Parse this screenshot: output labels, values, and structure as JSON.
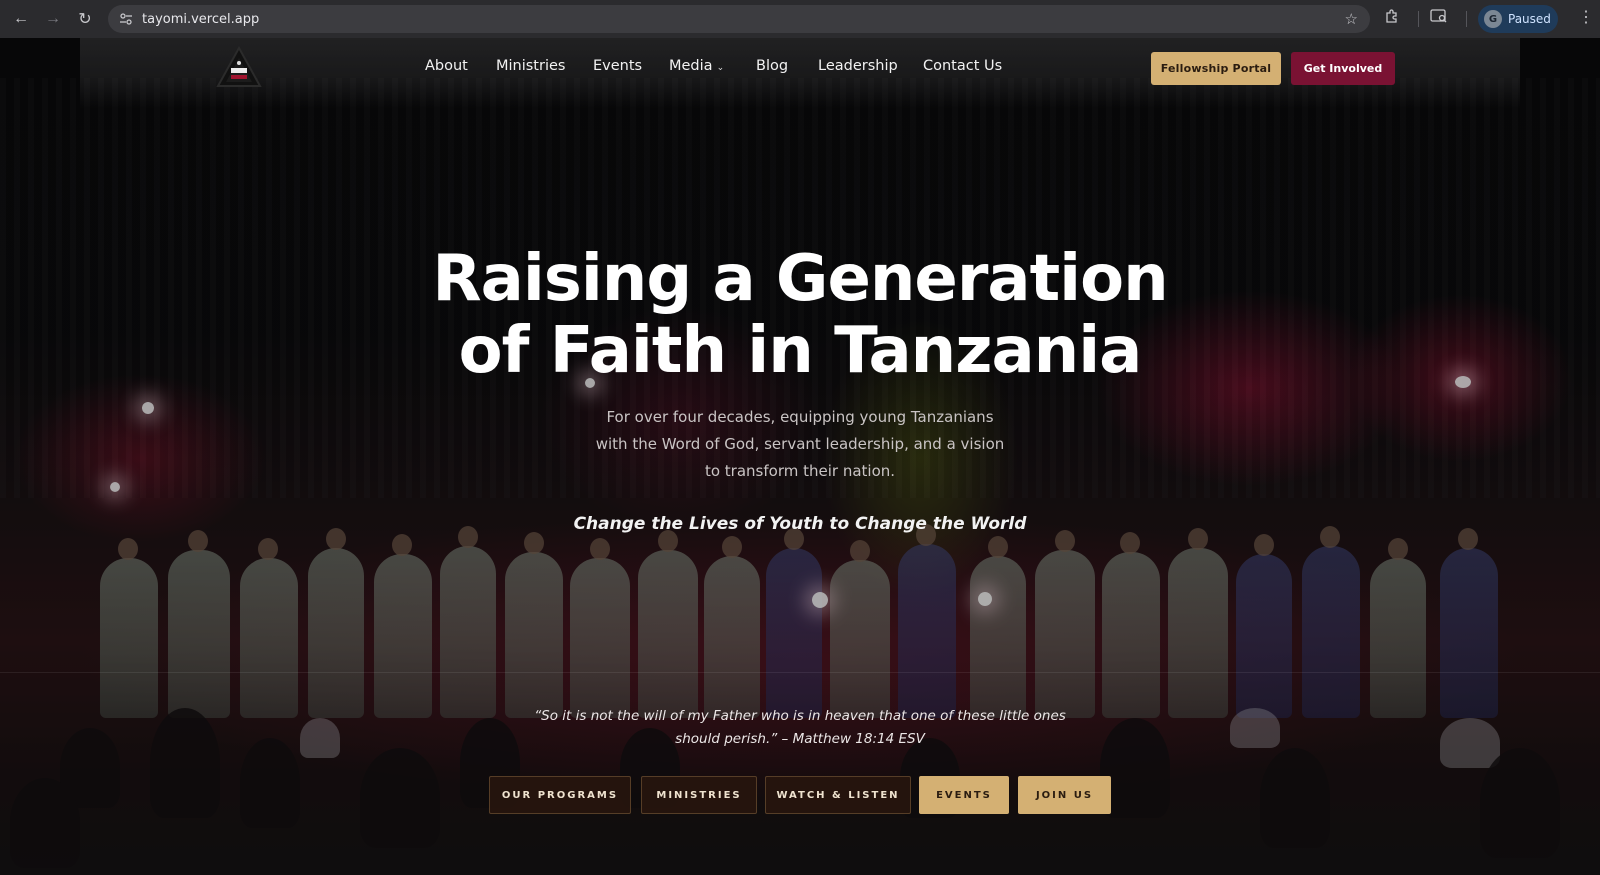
{
  "browser": {
    "url": "tayomi.vercel.app",
    "profile_initial": "G",
    "profile_label": "Paused"
  },
  "nav": {
    "links": [
      "About",
      "Ministries",
      "Events",
      "Media",
      "Blog",
      "Leadership",
      "Contact Us"
    ],
    "fellowship_portal": "Fellowship Portal",
    "get_involved": "Get Involved"
  },
  "hero": {
    "title_line1": "Raising a Generation",
    "title_line2": "of Faith in Tanzania",
    "subtitle": "For over four decades, equipping young Tanzanians with the Word of God, servant leadership, and a vision to transform their nation.",
    "tagline": "Change the Lives of Youth to Change the World",
    "verse": "“So it is not the will of my Father who is in heaven that one of these little ones should perish.” – Matthew 18:14 ESV"
  },
  "cta": {
    "programs": "OUR PROGRAMS",
    "ministries": "MINISTRIES",
    "watch": "WATCH & LISTEN",
    "events": "EVENTS",
    "join": "JOIN US"
  },
  "colors": {
    "gold": "#d4b073",
    "maroon": "#7a1233",
    "dark_button": "#28160e"
  },
  "icons": [
    "back-arrow-icon",
    "forward-arrow-icon",
    "reload-icon",
    "site-settings-icon",
    "bookmark-star-icon",
    "extensions-icon",
    "reader-mode-icon",
    "more-menu-icon",
    "chevron-down-icon",
    "logo-emblem"
  ]
}
